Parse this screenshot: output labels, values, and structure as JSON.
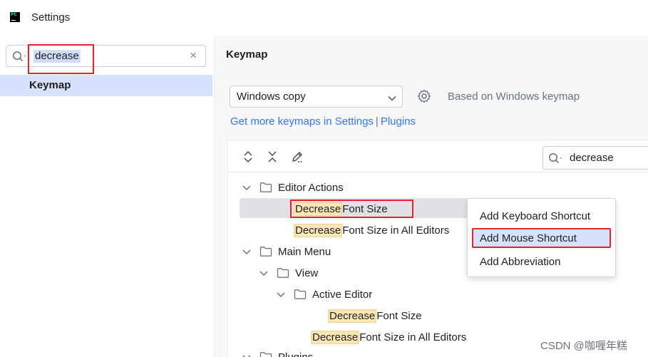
{
  "window": {
    "title": "Settings",
    "app_icon": "pycharm-icon"
  },
  "left_panel": {
    "search": {
      "value": "decrease",
      "clear_icon": "×"
    },
    "results": [
      {
        "label": "Keymap"
      }
    ]
  },
  "keymap": {
    "title": "Keymap",
    "selected_keymap": "Windows copy",
    "based_on": "Based on Windows keymap",
    "link_get_more": "Get more keymaps in Settings",
    "link_separator": "|",
    "link_plugins": "Plugins"
  },
  "toolbar": {
    "filter_value": "decrease"
  },
  "tree": {
    "editor_actions": "Editor Actions",
    "decrease_1_hl": "Decrease",
    "decrease_1_rest": " Font Size",
    "decrease_2_hl": "Decrease",
    "decrease_2_rest": " Font Size in All Editors",
    "main_menu": "Main Menu",
    "view": "View",
    "active_editor": "Active Editor",
    "decrease_3_hl": "Decrease",
    "decrease_3_rest": " Font Size",
    "decrease_4_hl": "Decrease",
    "decrease_4_rest": " Font Size in All Editors",
    "plugins": "Plugins"
  },
  "context_menu": {
    "items": [
      {
        "label": "Add Keyboard Shortcut"
      },
      {
        "label": "Add Mouse Shortcut"
      },
      {
        "label": "Add Abbreviation"
      }
    ]
  },
  "watermark": "CSDN @咖喱年糕",
  "colors": {
    "selection": "#d5e1fd",
    "highlight": "#fae7b5",
    "annotation_red": "#e0242a",
    "link": "#3574f0"
  }
}
